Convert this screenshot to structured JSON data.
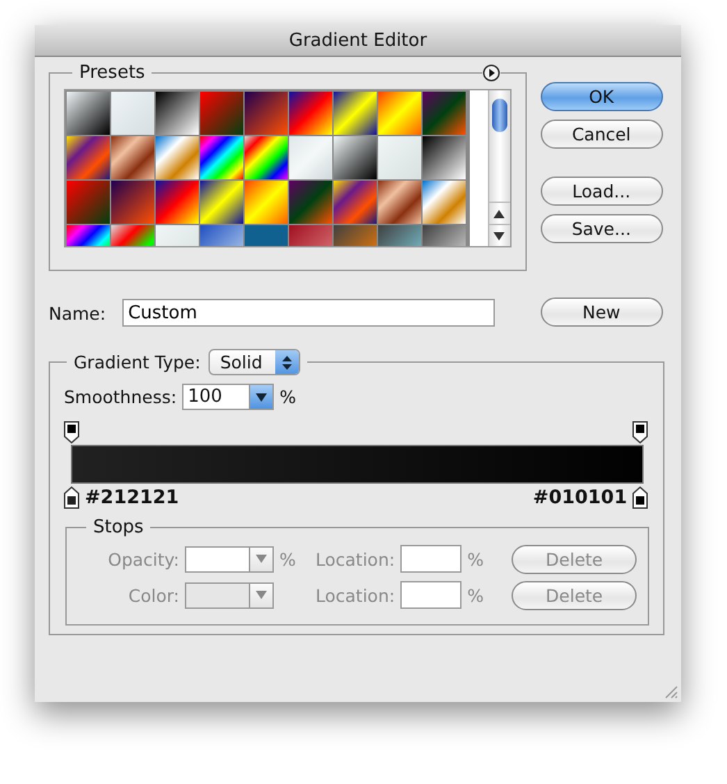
{
  "window": {
    "title": "Gradient Editor"
  },
  "presets": {
    "label": "Presets"
  },
  "buttons": [
    {
      "label": "OK",
      "kind": "default"
    },
    {
      "label": "Cancel",
      "kind": "normal"
    },
    {
      "label": "Load...",
      "kind": "normal"
    },
    {
      "label": "Save..."
    }
  ],
  "name": {
    "label": "Name:",
    "value": "Custom",
    "button": "New"
  },
  "gradient_type": {
    "label": "Gradient Type:",
    "value": "Solid"
  },
  "smoothness": {
    "label": "Smoothness:",
    "value": "100",
    "unit": "%"
  },
  "color_stops": [
    {
      "label": "#212121",
      "color": "#212121"
    },
    {
      "label": "#010101",
      "color": "#010101"
    }
  ],
  "stops": {
    "label": "Stops",
    "rows": [
      {
        "kind": "opacity",
        "label": "Opacity:",
        "unit": "%",
        "location_label": "Location:",
        "location_unit": "%",
        "button": "Delete",
        "disabled": true
      },
      {
        "kind": "color",
        "label": "Color:",
        "location_label": "Location:",
        "location_unit": "%",
        "button": "Delete",
        "disabled": true
      }
    ]
  }
}
